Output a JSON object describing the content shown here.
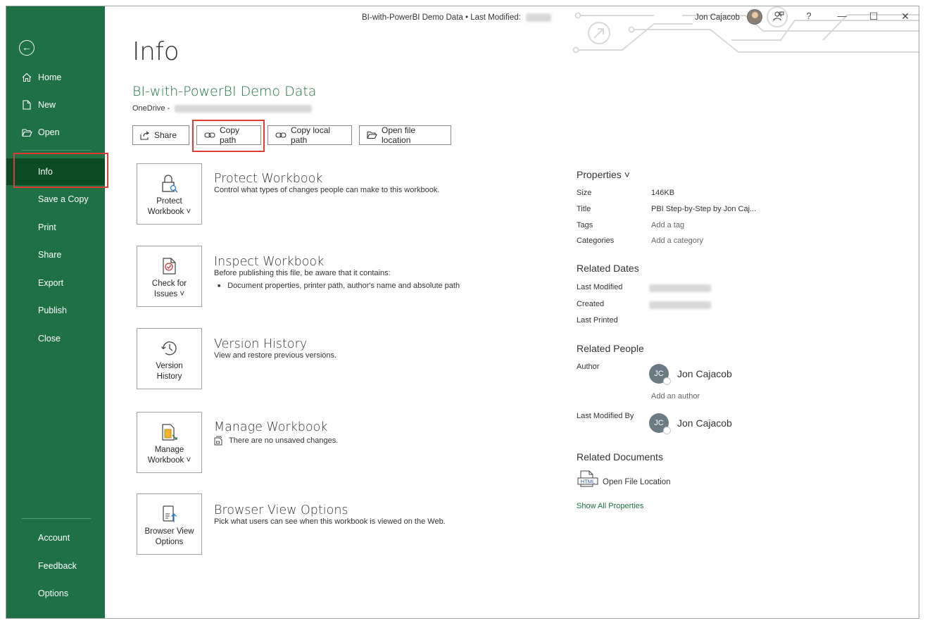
{
  "titlebar": {
    "document_title": "BI-with-PowerBI Demo Data • Last Modified:",
    "user_name": "Jon Cajacob",
    "help_label": "?",
    "minimize_label": "—",
    "maximize_label": "☐",
    "close_label": "✕"
  },
  "sidebar": {
    "back_label": "←",
    "items": [
      {
        "label": "Home",
        "icon": "home-icon"
      },
      {
        "label": "New",
        "icon": "new-document-icon"
      },
      {
        "label": "Open",
        "icon": "folder-open-icon"
      },
      {
        "label": "Info"
      },
      {
        "label": "Save a Copy"
      },
      {
        "label": "Print"
      },
      {
        "label": "Share"
      },
      {
        "label": "Export"
      },
      {
        "label": "Publish"
      },
      {
        "label": "Close"
      }
    ],
    "bottom_items": [
      {
        "label": "Account"
      },
      {
        "label": "Feedback"
      },
      {
        "label": "Options"
      }
    ],
    "active": "Info"
  },
  "main": {
    "page_title": "Info",
    "doc_name": "BI-with-PowerBI Demo Data",
    "doc_location_prefix": "OneDrive -",
    "actions": [
      {
        "label": "Share",
        "icon": "share-icon"
      },
      {
        "label": "Copy path",
        "icon": "link-icon"
      },
      {
        "label": "Copy local path",
        "icon": "link-icon"
      },
      {
        "label": "Open file location",
        "icon": "folder-open-icon"
      }
    ],
    "sections": [
      {
        "button_label": "Protect\nWorkbook ˅",
        "icon": "lock-icon",
        "title": "Protect Workbook",
        "description": "Control what types of changes people can make to this workbook."
      },
      {
        "button_label": "Check for\nIssues ˅",
        "icon": "inspect-document-icon",
        "title": "Inspect Workbook",
        "description": "Before publishing this file, be aware that it contains:",
        "bullets": [
          "Document properties, printer path, author's name and absolute path"
        ]
      },
      {
        "button_label": "Version\nHistory",
        "icon": "history-icon",
        "title": "Version History",
        "description": "View and restore previous versions."
      },
      {
        "button_label": "Manage\nWorkbook ˅",
        "icon": "manage-workbook-icon",
        "title": "Manage Workbook",
        "description": "There are no unsaved changes."
      },
      {
        "button_label": "Browser View\nOptions",
        "icon": "browser-view-icon",
        "title": "Browser View Options",
        "description": "Pick what users can see when this workbook is viewed on the Web."
      }
    ]
  },
  "properties": {
    "header": "Properties ˅",
    "rows": [
      {
        "label": "Size",
        "value": "146KB"
      },
      {
        "label": "Title",
        "value": "PBI Step-by-Step by Jon Caj..."
      },
      {
        "label": "Tags",
        "value": "Add a tag"
      },
      {
        "label": "Categories",
        "value": "Add a category"
      }
    ],
    "related_dates_header": "Related Dates",
    "dates": [
      {
        "label": "Last Modified"
      },
      {
        "label": "Created"
      },
      {
        "label": "Last Printed"
      }
    ],
    "related_people_header": "Related People",
    "author_label": "Author",
    "author_initials": "JC",
    "author_name": "Jon Cajacob",
    "add_author": "Add an author",
    "last_modified_by_label": "Last Modified By",
    "last_modified_by_initials": "JC",
    "last_modified_by_name": "Jon Cajacob",
    "related_documents_header": "Related Documents",
    "html_icon_text": "HTML",
    "open_file_location": "Open File Location",
    "show_all": "Show All Properties"
  },
  "colors": {
    "accent": "#1e7145",
    "active_nav": "#0b4a22",
    "highlight": "#e03c31"
  }
}
